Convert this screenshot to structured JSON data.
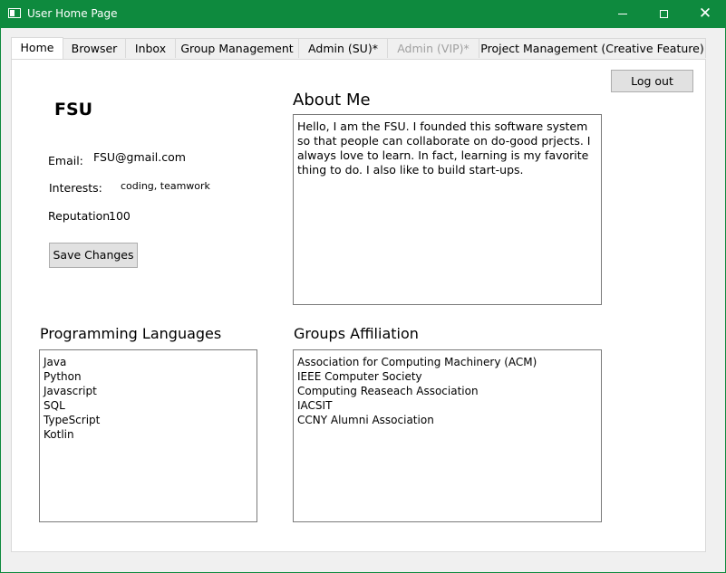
{
  "window": {
    "title": "User Home Page",
    "controls": {
      "minimize": "minimize",
      "maximize": "maximize",
      "close": "close"
    },
    "accent_color": "#0e8a3e"
  },
  "tabs": [
    {
      "label": "Home",
      "active": true
    },
    {
      "label": "Browser"
    },
    {
      "label": "Inbox"
    },
    {
      "label": "Group Management"
    },
    {
      "label": "Admin (SU)*"
    },
    {
      "label": "Admin (VIP)*",
      "disabled": true
    },
    {
      "label": "Project Management (Creative Feature)"
    }
  ],
  "profile": {
    "username": "FSU",
    "email_label": "Email:",
    "email_value": "FSU@gmail.com",
    "interests_label": "Interests:",
    "interests_value": "coding, teamwork",
    "reputation_label": "Reputation",
    "reputation_value": "100",
    "save_button": "Save Changes"
  },
  "logout_button": "Log out",
  "about": {
    "heading": "About Me",
    "text": "Hello, I am the FSU. I founded this software system so that people can collaborate on do-good prjects. I always love to learn. In fact, learning is my favorite thing to do. I also like to build start-ups."
  },
  "programming_languages": {
    "heading": "Programming Languages",
    "items": [
      "Java",
      "Python",
      "Javascript",
      "SQL",
      "TypeScript",
      "Kotlin"
    ]
  },
  "groups": {
    "heading": "Groups Affiliation",
    "items": [
      "Association for Computing Machinery (ACM)",
      "IEEE Computer Society",
      "Computing Reaseach Association",
      "IACSIT",
      "CCNY Alumni Association"
    ]
  }
}
